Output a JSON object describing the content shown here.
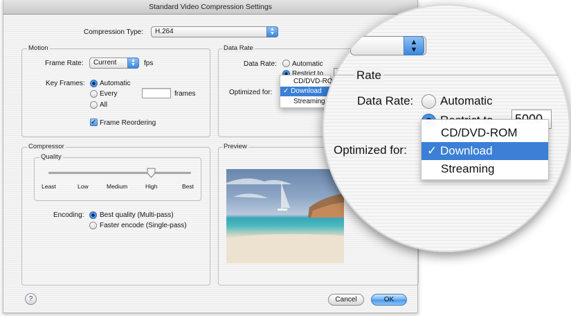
{
  "window": {
    "title": "Standard Video Compression Settings"
  },
  "compression": {
    "label": "Compression Type:",
    "value": "H.264"
  },
  "motion": {
    "title": "Motion",
    "frame_rate_label": "Frame Rate:",
    "frame_rate_value": "Current",
    "fps_label": "fps",
    "key_frames_label": "Key Frames:",
    "key_options": [
      "Automatic",
      "Every",
      "All"
    ],
    "selected_key": "Automatic",
    "frames_label": "frames",
    "frames_value": "",
    "reorder_label": "Frame Reordering",
    "reorder_checked": true
  },
  "data_rate": {
    "title": "Data Rate",
    "label": "Data Rate:",
    "automatic_label": "Automatic",
    "restrict_label": "Restrict to",
    "restrict_value": "5000",
    "optimized_label": "Optimized for:",
    "menu_items": [
      "CD/DVD-ROM",
      "Download",
      "Streaming"
    ],
    "selected_item": "Download",
    "checkmark": "✓"
  },
  "compressor": {
    "title": "Compressor",
    "quality_title": "Quality",
    "quality_ticks": [
      "Least",
      "Low",
      "Medium",
      "High",
      "Best"
    ],
    "quality_level": "High",
    "encoding_label": "Encoding:",
    "encoding_options": [
      "Best quality (Multi-pass)",
      "Faster encode (Single-pass)"
    ],
    "selected_encoding": "Best quality (Multi-pass)"
  },
  "preview": {
    "title": "Preview"
  },
  "buttons": {
    "help": "?",
    "cancel": "Cancel",
    "ok": "OK"
  },
  "magnifier": {
    "rate_label": "Rate",
    "data_rate_label": "Data Rate:",
    "automatic_label": "Automatic",
    "restrict_label": "Restrict to",
    "restrict_value": "5000",
    "optimized_label": "Optimized for:",
    "menu_items": [
      "CD/DVD-ROM",
      "Download",
      "Streaming"
    ],
    "selected_item": "Download",
    "checkmark": "✓"
  },
  "colors": {
    "accent": "#3b80d6",
    "window_bg": "#efefef"
  }
}
